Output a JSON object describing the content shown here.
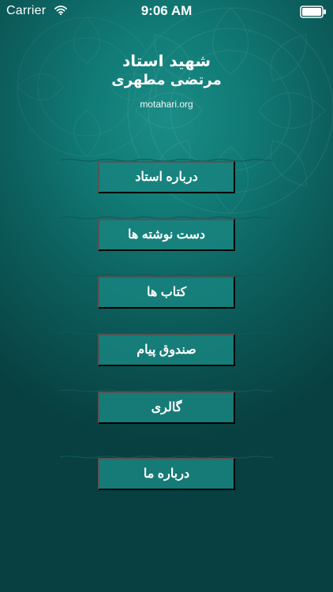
{
  "status_bar": {
    "carrier": "Carrier",
    "time": "9:06 AM"
  },
  "header": {
    "title_line1": "شهید استاد",
    "title_line2": "مرتضی مطهری",
    "url": "motahari.org"
  },
  "menu": {
    "items": [
      {
        "label": "درباره استاد"
      },
      {
        "label": "دست نوشته ها"
      },
      {
        "label": "کتاب ها"
      },
      {
        "label": "صندوق پیام"
      },
      {
        "label": "گالری"
      },
      {
        "label": "درباره ما"
      }
    ]
  },
  "icons": {
    "wifi": "wifi-icon",
    "battery": "battery-icon"
  },
  "colors": {
    "background": "#0c5f5d",
    "button": "#18847f",
    "text": "#ffffff"
  }
}
